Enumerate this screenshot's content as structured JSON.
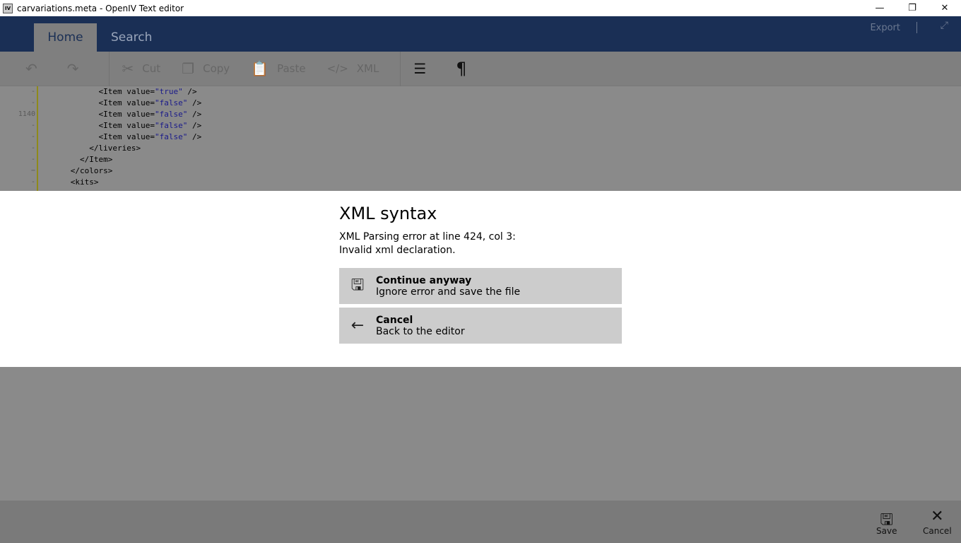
{
  "window": {
    "title": "carvariations.meta - OpenIV Text editor",
    "icon_text": "IV",
    "minimize": "—",
    "restore": "❐",
    "close": "✕"
  },
  "header": {
    "tabs": [
      {
        "label": "Home"
      },
      {
        "label": "Search"
      }
    ],
    "export_label": "Export",
    "expand_icon": "⤢"
  },
  "ribbon": {
    "undo": "↶",
    "redo": "↷",
    "cut": "Cut",
    "copy": "Copy",
    "paste": "Paste",
    "xml": "XML",
    "format_icon": "☰",
    "pilcrow": "¶"
  },
  "editor": {
    "lines": [
      {
        "num": "-",
        "indent": "            ",
        "tag": "<Item value=",
        "val": "\"true\"",
        "end": " />"
      },
      {
        "num": "-",
        "indent": "            ",
        "tag": "<Item value=",
        "val": "\"false\"",
        "end": " />"
      },
      {
        "num": "1140",
        "indent": "            ",
        "tag": "<Item value=",
        "val": "\"false\"",
        "end": " />"
      },
      {
        "num": "-",
        "indent": "            ",
        "tag": "<Item value=",
        "val": "\"false\"",
        "end": " />"
      },
      {
        "num": "-",
        "indent": "            ",
        "tag": "<Item value=",
        "val": "\"false\"",
        "end": " />"
      },
      {
        "num": "-",
        "indent": "          ",
        "tag": "</liveries>",
        "val": "",
        "end": ""
      },
      {
        "num": "-",
        "indent": "        ",
        "tag": "</Item>",
        "val": "",
        "end": ""
      },
      {
        "num": "−",
        "indent": "      ",
        "tag": "</colors>",
        "val": "",
        "end": ""
      },
      {
        "num": "-",
        "indent": "      ",
        "tag": "<kits>",
        "val": "",
        "end": ""
      }
    ]
  },
  "dialog": {
    "title": "XML syntax",
    "message_line1": "XML Parsing error at line 424, col 3:",
    "message_line2": "Invalid xml declaration.",
    "options": [
      {
        "title": "Continue anyway",
        "subtitle": "Ignore error and save the file",
        "icon": "💾"
      },
      {
        "title": "Cancel",
        "subtitle": "Back to the editor",
        "icon": "←"
      }
    ]
  },
  "bottom": {
    "save": "Save",
    "cancel": "Cancel"
  }
}
